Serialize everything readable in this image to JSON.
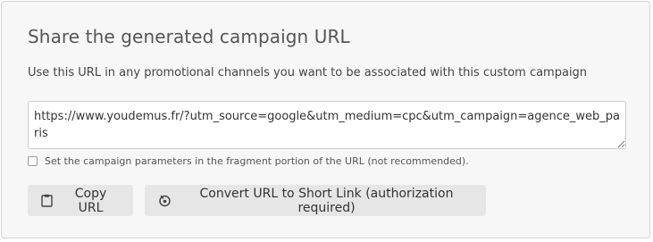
{
  "panel": {
    "title": "Share the generated campaign URL",
    "description": "Use this URL in any promotional channels you want to be associated with this custom campaign",
    "url_value": "https://www.youdemus.fr/?utm_source=google&utm_medium=cpc&utm_campaign=agence_web_paris",
    "fragment_checkbox": {
      "label": "Set the campaign parameters in the fragment portion of the URL (not recommended).",
      "checked": false
    }
  },
  "buttons": {
    "copy_label": "Copy URL",
    "copy_icon": "clipboard-icon",
    "short_link_label": "Convert URL to Short Link (authorization required)",
    "short_link_icon": "bitly-icon"
  }
}
